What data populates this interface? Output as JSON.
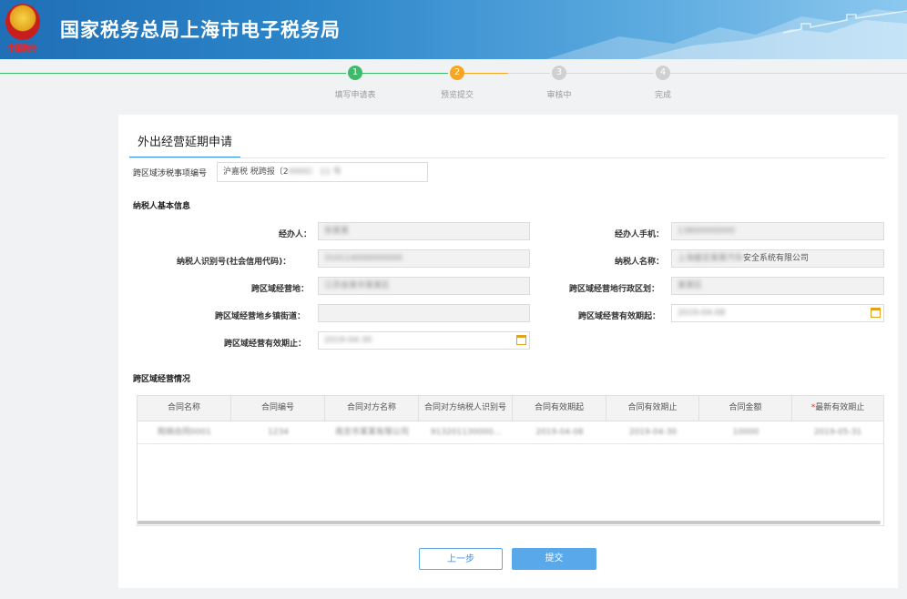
{
  "header": {
    "title": "国家税务总局上海市电子税务局",
    "emblem_text": "中国税务"
  },
  "stepper": {
    "steps": [
      {
        "num": "1",
        "label": "填写申请表",
        "state": "done",
        "color": "#3dbb6a"
      },
      {
        "num": "2",
        "label": "预览提交",
        "state": "current",
        "color": "#f6a623"
      },
      {
        "num": "3",
        "label": "审核中",
        "state": "todo",
        "color": "#d0d0d0"
      },
      {
        "num": "4",
        "label": "完成",
        "state": "todo",
        "color": "#d0d0d0"
      }
    ]
  },
  "form": {
    "tab": "外出经营延期申请",
    "matter_no_label": "跨区域涉税事项编号",
    "matter_no_value": "沪嘉税 税跨报〔2",
    "matter_no_hidden": "0000〕 11 号",
    "basic_section": "纳税人基本信息",
    "fields": {
      "agent_label": "经办人：",
      "agent_value": "张某某",
      "agent_phone_label": "经办人手机：",
      "agent_phone_value": "13800000000",
      "tax_id_label": "纳税人识别号(社会信用代码)：",
      "tax_id_value": "310114000000000",
      "taxpayer_name_label": "纳税人名称：",
      "taxpayer_name_prefix": "上海嘉定某某汽车",
      "taxpayer_name_visible": "安全系统有限公司",
      "location_label": "跨区域经营地：",
      "location_value": "江苏省某市某某区",
      "location_division_label": "跨区域经营地行政区划：",
      "location_division_value": "某某区",
      "street_label": "跨区域经营地乡镇街道：",
      "street_value": "",
      "valid_from_label": "跨区域经营有效期起：",
      "valid_from_value": "2019-04-08",
      "valid_to_label": "跨区域经营有效期止：",
      "valid_to_value": "2019-04-30"
    },
    "biz_section": "跨区域经营情况",
    "table": {
      "columns": [
        "合同名称",
        "合同编号",
        "合同对方名称",
        "合同对方纳税人识别号",
        "合同有效期起",
        "合同有效期止",
        "合同金额",
        "最新有效期止"
      ],
      "required_column_index": 7,
      "rows": [
        [
          "购销合同0001",
          "1234",
          "南京市某某有限公司",
          "913201130000...",
          "2019-04-08",
          "2019-04-30",
          "10000",
          "2019-05-31"
        ]
      ]
    },
    "buttons": {
      "prev": "上一步",
      "submit": "提交"
    }
  },
  "colors": {
    "header_start": "#1f6fb6",
    "accent_blue": "#3a8ee6",
    "step_done": "#3dbb6a",
    "step_current": "#f6a623",
    "required": "#e8262b"
  }
}
